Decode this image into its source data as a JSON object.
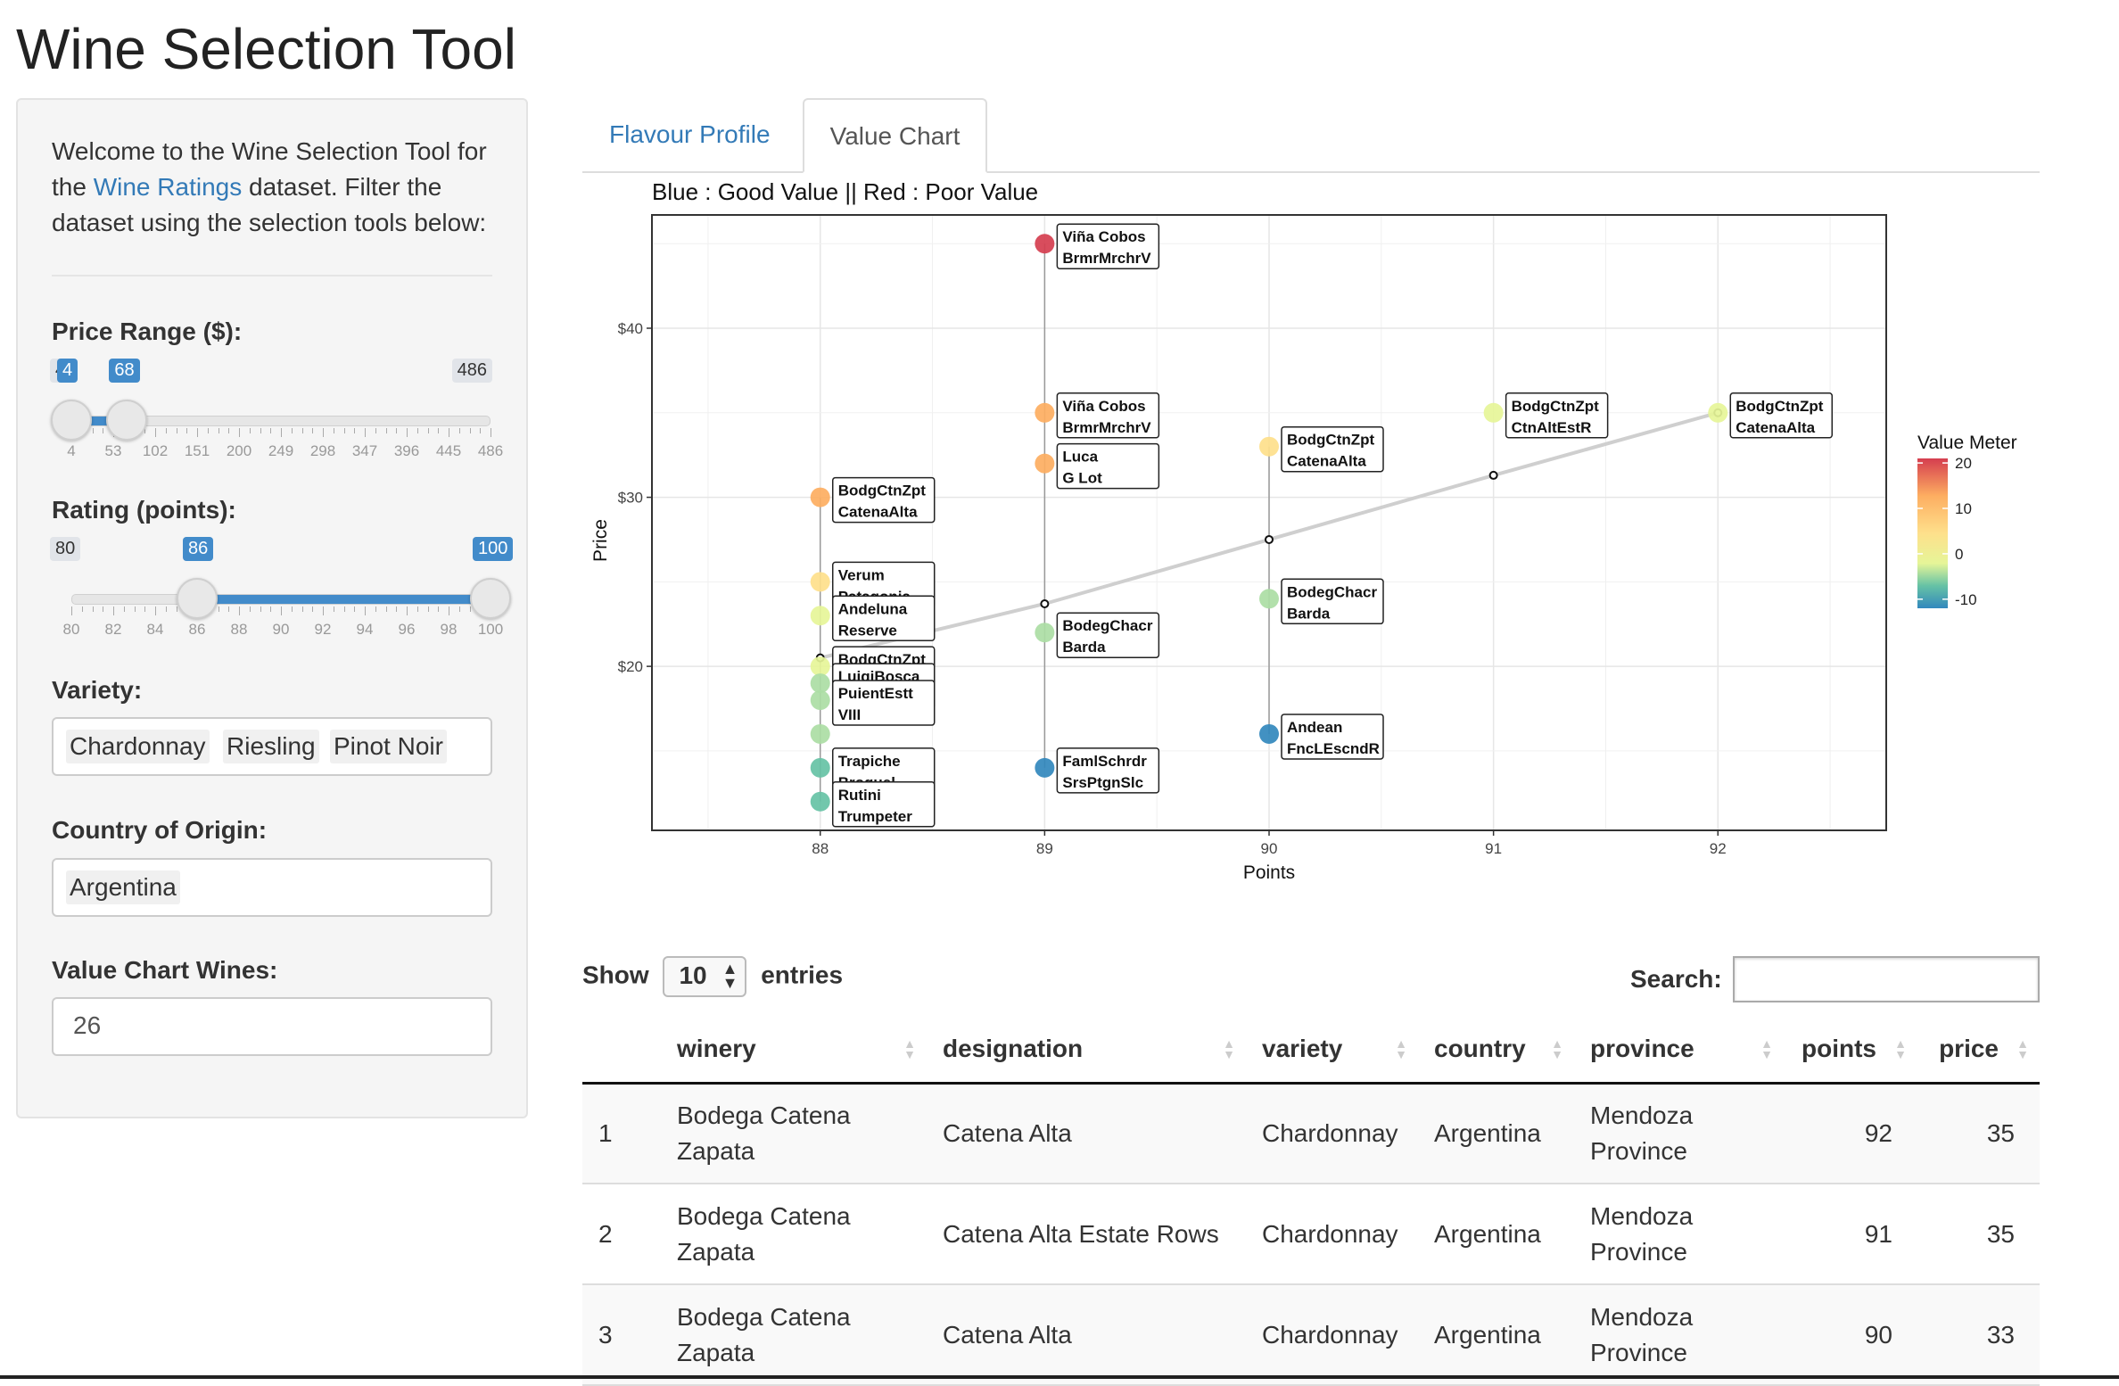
{
  "app_title": "Wine Selection Tool",
  "sidebar": {
    "welcome_pre": "Welcome to the Wine Selection Tool for the ",
    "welcome_link": "Wine Ratings",
    "welcome_post": " dataset. Filter the dataset using the selection tools below:",
    "price": {
      "label": "Price Range ($):",
      "min": "4",
      "max": "486",
      "low": "4",
      "high": "68",
      "ticks": [
        "4",
        "53",
        "102",
        "151",
        "200",
        "249",
        "298",
        "347",
        "396",
        "445",
        "486"
      ]
    },
    "rating": {
      "label": "Rating (points):",
      "min": "80",
      "max": "100",
      "low": "86",
      "high": "100",
      "ticks": [
        "80",
        "82",
        "84",
        "86",
        "88",
        "90",
        "92",
        "94",
        "96",
        "98",
        "100"
      ]
    },
    "variety": {
      "label": "Variety:",
      "selected": [
        "Chardonnay",
        "Riesling",
        "Pinot Noir"
      ]
    },
    "country": {
      "label": "Country of Origin:",
      "selected": [
        "Argentina"
      ]
    },
    "value_chart_wines": {
      "label": "Value Chart Wines:",
      "value": "26"
    }
  },
  "tabs": [
    "Flavour Profile",
    "Value Chart"
  ],
  "active_tab": "Value Chart",
  "chart_data": {
    "type": "scatter",
    "title": "Blue : Good Value || Red : Poor Value",
    "xlabel": "Points",
    "ylabel": "Price",
    "xlim": [
      87.25,
      92.75
    ],
    "ylim": [
      10.3,
      46.7
    ],
    "x_ticks": [
      "88",
      "89",
      "90",
      "91",
      "92"
    ],
    "y_ticks": [
      "$20",
      "$30",
      "$40"
    ],
    "y_tick_values": [
      20,
      30,
      40
    ],
    "legend": {
      "title": "Value Meter",
      "ticks": [
        "20",
        "10",
        "0",
        "-10"
      ],
      "tick_values": [
        20,
        10,
        0,
        -10
      ],
      "range": [
        -12,
        21
      ],
      "position": "right"
    },
    "colors": {
      "red": "#d53e4f",
      "orange": "#fdae61",
      "yellow": "#fee08b",
      "paleyellow": "#e6f598",
      "lightgreen": "#abdda4",
      "green": "#66c2a5",
      "blue": "#3288bd"
    },
    "trend_line": {
      "x": [
        88,
        89,
        90,
        91,
        92
      ],
      "y": [
        20.5,
        23.7,
        27.5,
        31.3,
        35
      ]
    },
    "points": [
      {
        "x": 89,
        "y": 45,
        "color": "red",
        "label": [
          "Viña Cobos",
          "BrmrMrchrV"
        ]
      },
      {
        "x": 89,
        "y": 35,
        "color": "orange",
        "label": [
          "Viña Cobos",
          "BrmrMrchrV"
        ]
      },
      {
        "x": 89,
        "y": 32,
        "color": "orange",
        "label": [
          "Luca",
          "G Lot"
        ]
      },
      {
        "x": 89,
        "y": 22,
        "color": "lightgreen",
        "label": [
          "BodegChacr",
          "Barda"
        ]
      },
      {
        "x": 89,
        "y": 14,
        "color": "blue",
        "label": [
          "FamlSchrdr",
          "SrsPtgnSlc"
        ]
      },
      {
        "x": 88,
        "y": 30,
        "color": "orange",
        "label": [
          "BodgCtnZpt",
          "CatenaAlta"
        ]
      },
      {
        "x": 88,
        "y": 25,
        "color": "yellow",
        "label": [
          "Verum",
          "Patagonia"
        ]
      },
      {
        "x": 88,
        "y": 23,
        "color": "paleyellow",
        "label": [
          "Andeluna",
          "Reserve"
        ]
      },
      {
        "x": 88,
        "y": 20,
        "color": "paleyellow",
        "label": [
          "BodgCtnZpt",
          "Catena"
        ]
      },
      {
        "x": 88,
        "y": 19,
        "color": "lightgreen",
        "label": [
          "LuigiBosca",
          "Reserva"
        ]
      },
      {
        "x": 88,
        "y": 18,
        "color": "lightgreen",
        "label": [
          "PuientEstt",
          "VIII"
        ]
      },
      {
        "x": 88,
        "y": 16,
        "color": "lightgreen",
        "label": []
      },
      {
        "x": 88,
        "y": 14,
        "color": "green",
        "label": [
          "Trapiche",
          "Broquel"
        ]
      },
      {
        "x": 88,
        "y": 12,
        "color": "green",
        "label": [
          "Rutini",
          "Trumpeter"
        ]
      },
      {
        "x": 90,
        "y": 33,
        "color": "yellow",
        "label": [
          "BodgCtnZpt",
          "CatenaAlta"
        ]
      },
      {
        "x": 90,
        "y": 24,
        "color": "lightgreen",
        "label": [
          "BodegChacr",
          "Barda"
        ]
      },
      {
        "x": 90,
        "y": 16,
        "color": "blue",
        "label": [
          "Andean",
          "FncLEscndR"
        ]
      },
      {
        "x": 91,
        "y": 35,
        "color": "paleyellow",
        "label": [
          "BodgCtnZpt",
          "CtnAltEstR"
        ]
      },
      {
        "x": 92,
        "y": 35,
        "color": "paleyellow",
        "label": [
          "BodgCtnZpt",
          "CatenaAlta"
        ]
      }
    ]
  },
  "table": {
    "show_label": "Show",
    "entries_label": "entries",
    "page_length": "10",
    "search_label": "Search:",
    "columns": [
      "",
      "winery",
      "designation",
      "variety",
      "country",
      "province",
      "points",
      "price"
    ],
    "rows": [
      {
        "idx": "1",
        "winery": "Bodega Catena Zapata",
        "designation": "Catena Alta",
        "variety": "Chardonnay",
        "country": "Argentina",
        "province": "Mendoza Province",
        "points": "92",
        "price": "35"
      },
      {
        "idx": "2",
        "winery": "Bodega Catena Zapata",
        "designation": "Catena Alta Estate Rows",
        "variety": "Chardonnay",
        "country": "Argentina",
        "province": "Mendoza Province",
        "points": "91",
        "price": "35"
      },
      {
        "idx": "3",
        "winery": "Bodega Catena Zapata",
        "designation": "Catena Alta",
        "variety": "Chardonnay",
        "country": "Argentina",
        "province": "Mendoza Province",
        "points": "90",
        "price": "33"
      }
    ]
  }
}
